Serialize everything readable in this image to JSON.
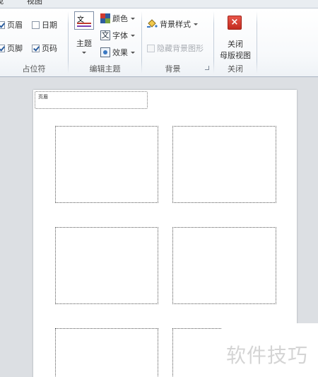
{
  "tabs": [
    {
      "label": "视图"
    }
  ],
  "ribbon": {
    "placeholders_group": {
      "header": {
        "label": "页眉",
        "checked": true
      },
      "date": {
        "label": "日期",
        "checked": false
      },
      "footer": {
        "label": "页脚",
        "checked": true
      },
      "page_number": {
        "label": "页码",
        "checked": true
      },
      "group_label": "占位符"
    },
    "edit_theme_group": {
      "theme_icon_text": "文",
      "theme_label": "主题",
      "colors_label": "颜色",
      "fonts_label": "字体",
      "fonts_icon_text": "文",
      "effects_label": "效果",
      "group_label": "编辑主题"
    },
    "background_group": {
      "background_styles_label": "背景样式",
      "hide_background_label": "隐藏背景图形",
      "hide_background_checked": false,
      "group_label": "背景"
    },
    "close_group": {
      "close_icon": "×",
      "close_line1": "关闭",
      "close_line2": "母版视图",
      "group_label": "关闭"
    }
  },
  "slide": {
    "header_placeholder_text": "页眉"
  },
  "watermark": "软件技巧",
  "colors": {
    "accent_red": "#d0392f",
    "ribbon_bg": "#f7f9fb",
    "workspace_bg": "#dcdfe3"
  }
}
